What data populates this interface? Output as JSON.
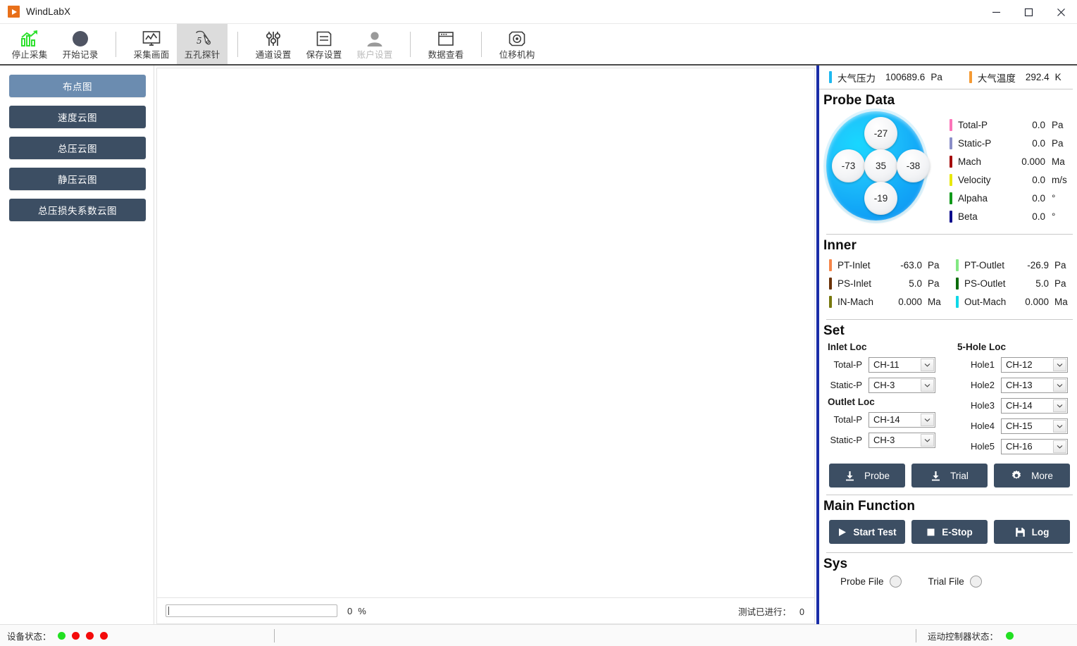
{
  "window": {
    "title": "WindLabX",
    "logo_icon": "play-logo-icon",
    "minimize_label": "−",
    "maximize_label": "□",
    "close_label": "✕"
  },
  "toolbar": {
    "items": [
      {
        "label": "停止采集",
        "icon": "bar-chart-up-icon",
        "state": "normal"
      },
      {
        "label": "开始记录",
        "icon": "record-circle-icon",
        "state": "normal"
      },
      {
        "label": "采集画面",
        "icon": "monitor-waveform-icon",
        "state": "normal"
      },
      {
        "label": "五孔探针",
        "icon": "five-hole-probe-icon",
        "state": "active"
      },
      {
        "label": "通道设置",
        "icon": "sliders-icon",
        "state": "normal"
      },
      {
        "label": "保存设置",
        "icon": "floppy-save-icon",
        "state": "normal"
      },
      {
        "label": "账户设置",
        "icon": "user-account-icon",
        "state": "disabled"
      },
      {
        "label": "数据查看",
        "icon": "window-data-icon",
        "state": "normal"
      },
      {
        "label": "位移机构",
        "icon": "motor-stage-icon",
        "state": "normal"
      }
    ]
  },
  "sidebar": {
    "items": [
      {
        "label": "布点图",
        "selected": true
      },
      {
        "label": "速度云图",
        "selected": false
      },
      {
        "label": "总压云图",
        "selected": false
      },
      {
        "label": "静压云图",
        "selected": false
      },
      {
        "label": "总压损失系数云图",
        "selected": false
      }
    ]
  },
  "canvas": {
    "progress": {
      "value": "0",
      "unit": "%",
      "percent": 0
    },
    "test_counter": {
      "label": "测试已进行：",
      "value": "0"
    }
  },
  "right_panel": {
    "atmosphere": [
      {
        "name": "大气压力",
        "value": "100689.6",
        "unit": "Pa",
        "color": "#1eb9f0"
      },
      {
        "name": "大气温度",
        "value": "292.4",
        "unit": "K",
        "color": "#f59a34"
      }
    ],
    "probe_data": {
      "title": "Probe Data",
      "holes": {
        "top": "-27",
        "left": "-73",
        "center": "35",
        "right": "-38",
        "bottom": "-19"
      },
      "values": [
        {
          "name": "Total-P",
          "value": "0.0",
          "unit": "Pa",
          "color": "#fc74b9"
        },
        {
          "name": "Static-P",
          "value": "0.0",
          "unit": "Pa",
          "color": "#8a8ec8"
        },
        {
          "name": "Mach",
          "value": "0.000",
          "unit": "Ma",
          "color": "#a50c0c"
        },
        {
          "name": "Velocity",
          "value": "0.0",
          "unit": "m/s",
          "color": "#e8e80c"
        },
        {
          "name": "Alpaha",
          "value": "0.0",
          "unit": "°",
          "color": "#10991a"
        },
        {
          "name": "Beta",
          "value": "0.0",
          "unit": "°",
          "color": "#0b0b8c"
        }
      ]
    },
    "inner": {
      "title": "Inner",
      "left": [
        {
          "name": "PT-Inlet",
          "value": "-63.0",
          "unit": "Pa",
          "color": "#f6864a"
        },
        {
          "name": "PS-Inlet",
          "value": "5.0",
          "unit": "Pa",
          "color": "#6b3208"
        },
        {
          "name": "IN-Mach",
          "value": "0.000",
          "unit": "Ma",
          "color": "#77780d"
        }
      ],
      "right": [
        {
          "name": "PT-Outlet",
          "value": "-26.9",
          "unit": "Pa",
          "color": "#82e882"
        },
        {
          "name": "PS-Outlet",
          "value": "5.0",
          "unit": "Pa",
          "color": "#0b6b0b"
        },
        {
          "name": "Out-Mach",
          "value": "0.000",
          "unit": "Ma",
          "color": "#0fd8e8"
        }
      ]
    },
    "set": {
      "title": "Set",
      "inlet_title": "Inlet Loc",
      "outlet_title": "Outlet Loc",
      "hole_title": "5-Hole Loc",
      "inlet": [
        {
          "label": "Total-P",
          "value": "CH-11"
        },
        {
          "label": "Static-P",
          "value": "CH-3"
        }
      ],
      "outlet": [
        {
          "label": "Total-P",
          "value": "CH-14"
        },
        {
          "label": "Static-P",
          "value": "CH-3"
        }
      ],
      "holes": [
        {
          "label": "Hole1",
          "value": "CH-12"
        },
        {
          "label": "Hole2",
          "value": "CH-13"
        },
        {
          "label": "Hole3",
          "value": "CH-14"
        },
        {
          "label": "Hole4",
          "value": "CH-15"
        },
        {
          "label": "Hole5",
          "value": "CH-16"
        }
      ],
      "buttons": [
        {
          "label": "Probe",
          "icon": "download-icon"
        },
        {
          "label": "Trial",
          "icon": "download-icon"
        },
        {
          "label": "More",
          "icon": "gear-icon"
        }
      ]
    },
    "main_function": {
      "title": "Main Function",
      "buttons": [
        {
          "label": "Start Test",
          "icon": "play-icon"
        },
        {
          "label": "E-Stop",
          "icon": "stop-square-icon"
        },
        {
          "label": "Log",
          "icon": "save-icon"
        }
      ]
    },
    "sys": {
      "title": "Sys",
      "items": [
        {
          "label": "Probe File",
          "state": "off"
        },
        {
          "label": "Trial File",
          "state": "off"
        }
      ]
    }
  },
  "statusbar": {
    "device_label": "设备状态：",
    "device_leds": [
      "green",
      "red",
      "red",
      "red"
    ],
    "motion_label": "运动控制器状态：",
    "motion_led": "green"
  }
}
